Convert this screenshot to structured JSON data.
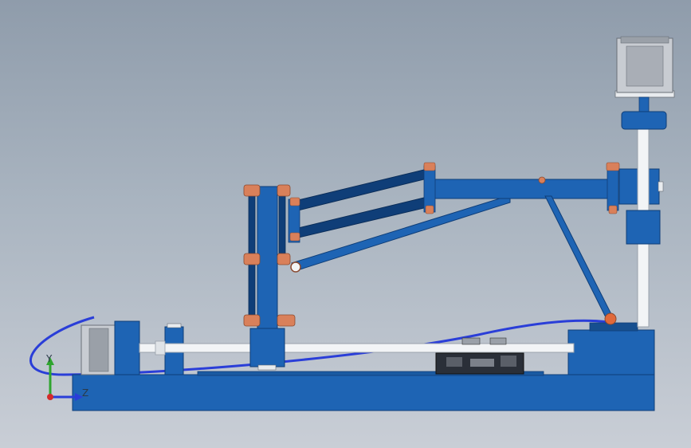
{
  "triad": {
    "y_label": "Y",
    "z_label": "Z"
  },
  "colors": {
    "part_blue": "#1e64b4",
    "part_blue_dark": "#0f3e78",
    "rod_white": "#f2f4f6",
    "copper": "#d9805a",
    "motor_gray": "#c8ccd2",
    "cable_blue": "#2a3ed8"
  },
  "components": [
    "base-plate",
    "left-stepper-motor",
    "linear-guide-rod",
    "carriage-block",
    "vertical-link-arm",
    "parallel-arm-upper",
    "parallel-arm-lower",
    "horizontal-boom",
    "diagonal-brace",
    "vertical-column",
    "top-servo-motor",
    "right-base-block",
    "circuit-board",
    "cable"
  ]
}
